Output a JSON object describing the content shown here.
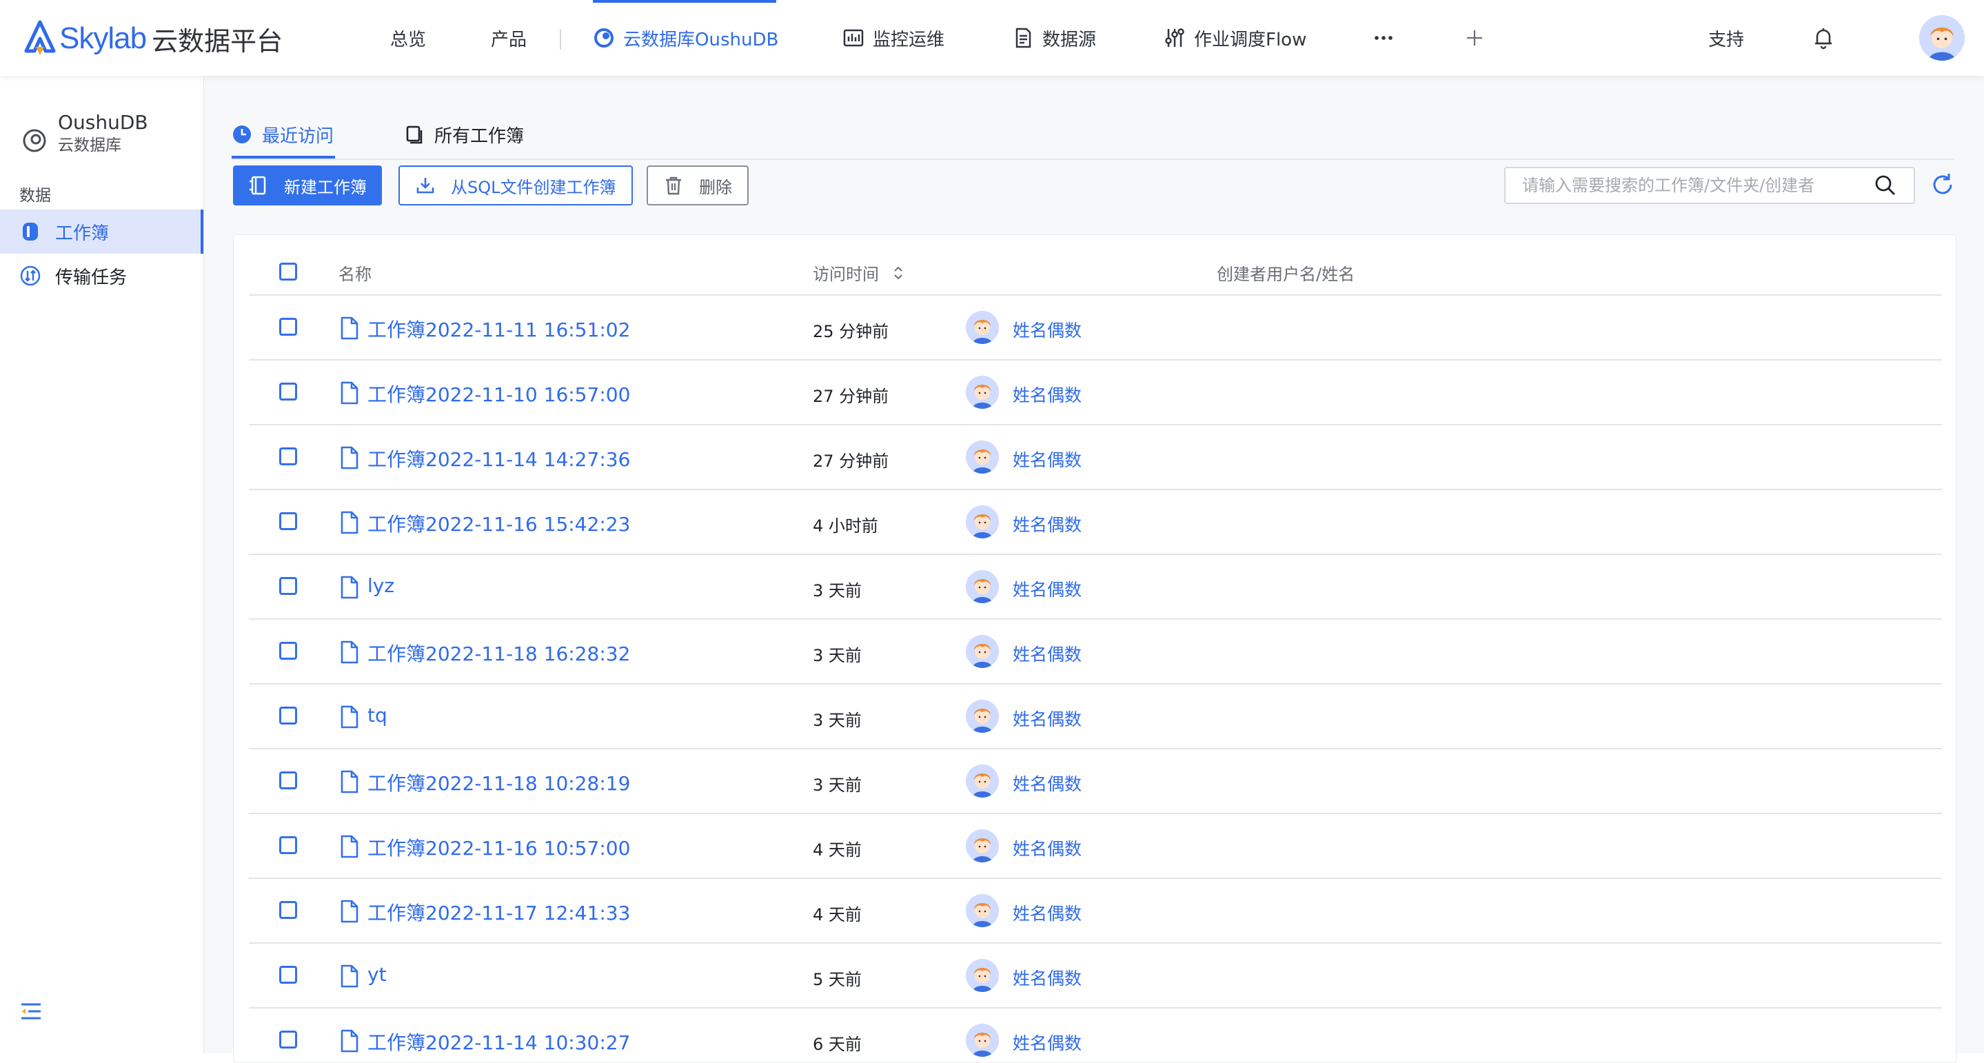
{
  "header": {
    "logo_word": "Skylab",
    "logo_cn": "云数据平台",
    "nav": [
      {
        "label": "总览",
        "icon": "none"
      },
      {
        "label": "产品",
        "icon": "none"
      },
      {
        "label": "云数据库OushuDB",
        "icon": "oushudb-icon",
        "active": true
      },
      {
        "label": "监控运维",
        "icon": "monitor-icon"
      },
      {
        "label": "数据源",
        "icon": "datasource-icon"
      },
      {
        "label": "作业调度Flow",
        "icon": "flow-icon"
      }
    ],
    "more_icon": "ellipsis-icon",
    "add_icon": "plus-icon",
    "support_label": "支持",
    "bell_icon": "bell-icon",
    "accent_color": "#2f6bea"
  },
  "sidebar": {
    "product_name": "OushuDB",
    "product_sub": "云数据库",
    "group_label": "数据",
    "items": [
      {
        "label": "工作簿",
        "icon": "workbook-icon",
        "active": true
      },
      {
        "label": "传输任务",
        "icon": "transfer-icon",
        "active": false
      }
    ],
    "collapse_icon": "collapse-menu-icon"
  },
  "tabs": [
    {
      "label": "最近访问",
      "icon": "clock-icon",
      "active": true
    },
    {
      "label": "所有工作簿",
      "icon": "copy-icon",
      "active": false
    }
  ],
  "toolbar": {
    "new_label": "新建工作簿",
    "from_sql_label": "从SQL文件创建工作簿",
    "delete_label": "删除",
    "search_placeholder": "请输入需要搜索的工作簿/文件夹/创建者",
    "refresh_icon": "refresh-icon"
  },
  "table": {
    "columns": {
      "name": "名称",
      "time": "访问时间",
      "creator": "创建者用户名/姓名"
    },
    "rows": [
      {
        "name": "工作簿2022-11-11 16:51:02",
        "time": "25 分钟前",
        "creator": "姓名偶数"
      },
      {
        "name": "工作簿2022-11-10 16:57:00",
        "time": "27 分钟前",
        "creator": "姓名偶数"
      },
      {
        "name": "工作簿2022-11-14 14:27:36",
        "time": "27 分钟前",
        "creator": "姓名偶数"
      },
      {
        "name": "工作簿2022-11-16 15:42:23",
        "time": "4 小时前",
        "creator": "姓名偶数"
      },
      {
        "name": "lyz",
        "time": "3 天前",
        "creator": "姓名偶数"
      },
      {
        "name": "工作簿2022-11-18 16:28:32",
        "time": "3 天前",
        "creator": "姓名偶数"
      },
      {
        "name": "tq",
        "time": "3 天前",
        "creator": "姓名偶数"
      },
      {
        "name": "工作簿2022-11-18 10:28:19",
        "time": "3 天前",
        "creator": "姓名偶数"
      },
      {
        "name": "工作簿2022-11-16 10:57:00",
        "time": "4 天前",
        "creator": "姓名偶数"
      },
      {
        "name": "工作簿2022-11-17 12:41:33",
        "time": "4 天前",
        "creator": "姓名偶数"
      },
      {
        "name": "yt",
        "time": "5 天前",
        "creator": "姓名偶数"
      },
      {
        "name": "工作簿2022-11-14 10:30:27",
        "time": "6 天前",
        "creator": "姓名偶数"
      }
    ]
  }
}
